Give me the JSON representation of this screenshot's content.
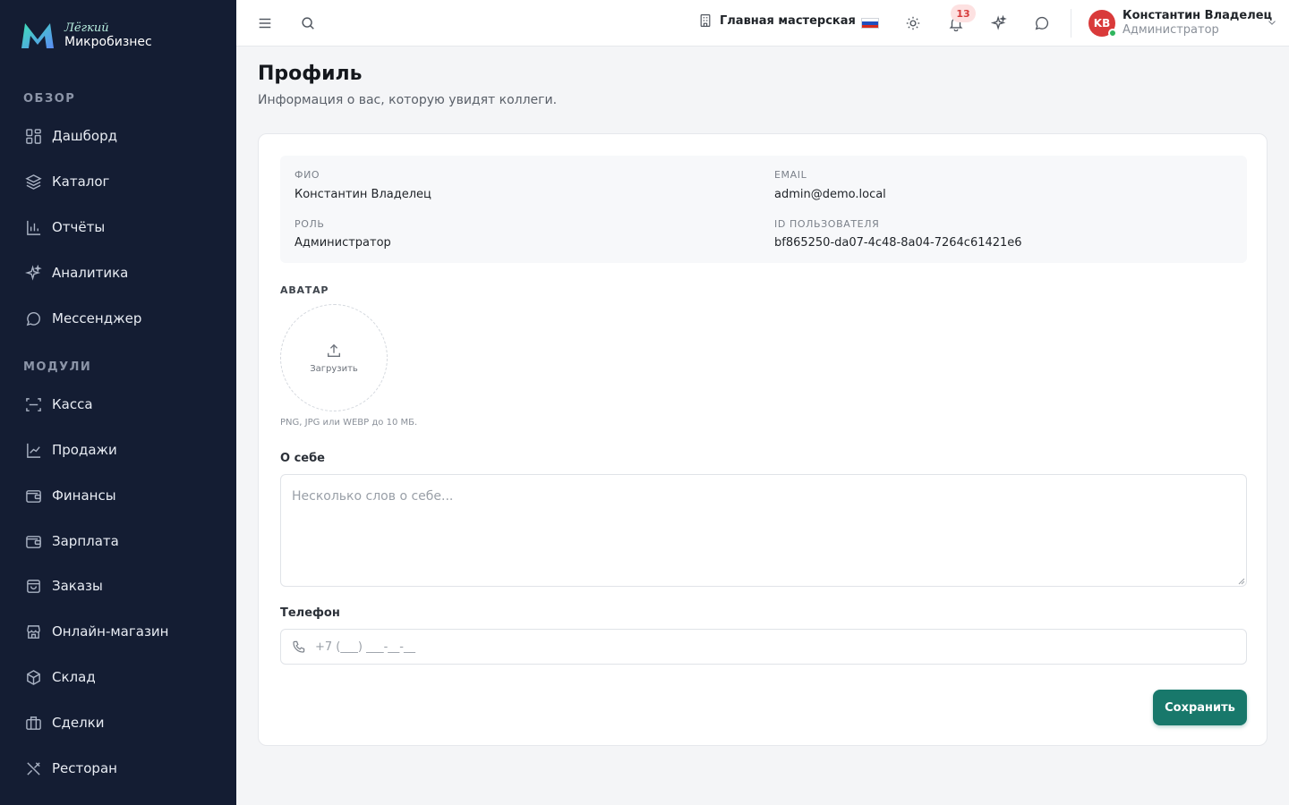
{
  "brand": {
    "line1": "Лёгкий",
    "line2": "Микробизнес",
    "colors": {
      "sidebar": "#141d33",
      "accent": "#18786b",
      "logo_gradient": [
        "#3ee0b8",
        "#5b8cf5"
      ]
    }
  },
  "sidebar": {
    "sections": [
      {
        "label": "ОБЗОР",
        "items": [
          {
            "label": "Дашборд",
            "icon": "dashboard-icon"
          },
          {
            "label": "Каталог",
            "icon": "catalog-icon"
          },
          {
            "label": "Отчёты",
            "icon": "reports-icon"
          },
          {
            "label": "Аналитика",
            "icon": "sparkles-icon"
          },
          {
            "label": "Мессенджер",
            "icon": "chat-icon"
          }
        ]
      },
      {
        "label": "МОДУЛИ",
        "items": [
          {
            "label": "Касса",
            "icon": "scan-icon"
          },
          {
            "label": "Продажи",
            "icon": "trend-icon"
          },
          {
            "label": "Финансы",
            "icon": "wallet-icon"
          },
          {
            "label": "Зарплата",
            "icon": "wallet-icon"
          },
          {
            "label": "Заказы",
            "icon": "bag-icon"
          },
          {
            "label": "Онлайн-магазин",
            "icon": "store-icon"
          },
          {
            "label": "Склад",
            "icon": "box-icon"
          },
          {
            "label": "Сделки",
            "icon": "briefcase-icon"
          },
          {
            "label": "Ресторан",
            "icon": "utensils-icon"
          }
        ]
      }
    ]
  },
  "topbar": {
    "workshop": "Главная мастерская",
    "language_flag": "ru-flag",
    "notifications_count": "13",
    "user": {
      "initials": "KB",
      "name": "Константин Владелец",
      "role": "Администратор"
    }
  },
  "page": {
    "title": "Профиль",
    "subtitle": "Информация о вас, которую увидят коллеги."
  },
  "profile": {
    "full_name_label": "ФИО",
    "full_name": "Константин Владелец",
    "email_label": "EMAIL",
    "email": "admin@demo.local",
    "role_label": "РОЛЬ",
    "role": "Администратор",
    "user_id_label": "ID ПОЛЬЗОВАТЕЛЯ",
    "user_id": "bf865250-da07-4c48-8a04-7264c61421e6",
    "avatar_label": "АВАТАР",
    "upload_label": "Загрузить",
    "upload_hint": "PNG, JPG или WEBP до 10 МБ.",
    "about_label": "О себе",
    "about_placeholder": "Несколько слов о себе...",
    "about_value": "",
    "phone_label": "Телефон",
    "phone_placeholder": "+7 (___) ___-__-__",
    "phone_value": "",
    "save_label": "Сохранить"
  }
}
